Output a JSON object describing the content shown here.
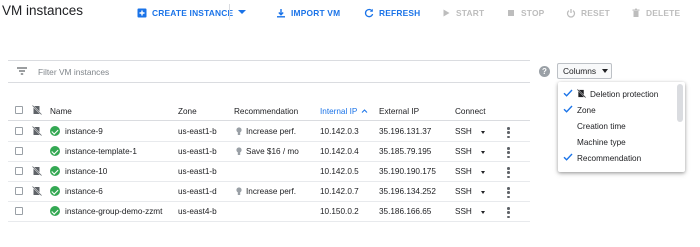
{
  "header": {
    "title": "VM instances"
  },
  "toolbar": {
    "create": "CREATE INSTANCE",
    "import": "IMPORT VM",
    "refresh": "REFRESH",
    "start": "START",
    "stop": "STOP",
    "reset": "RESET",
    "delete": "DELETE"
  },
  "filter": {
    "placeholder": "Filter VM instances"
  },
  "columns_button": {
    "label": "Columns"
  },
  "table": {
    "headers": {
      "name": "Name",
      "zone": "Zone",
      "recommendation": "Recommendation",
      "internal_ip": "Internal IP",
      "external_ip": "External IP",
      "connect": "Connect"
    },
    "rows": [
      {
        "name": "instance-9",
        "zone": "us-east1-b",
        "recommendation": "Increase perf.",
        "internal_ip": "10.142.0.3",
        "external_ip": "35.196.131.37",
        "connect": "SSH",
        "deletion_protection": true
      },
      {
        "name": "instance-template-1",
        "zone": "us-east1-b",
        "recommendation": "Save $16 / mo",
        "internal_ip": "10.142.0.4",
        "external_ip": "35.185.79.195",
        "connect": "SSH",
        "deletion_protection": false
      },
      {
        "name": "instance-10",
        "zone": "us-east1-b",
        "recommendation": "",
        "internal_ip": "10.142.0.5",
        "external_ip": "35.190.190.175",
        "connect": "SSH",
        "deletion_protection": true
      },
      {
        "name": "instance-6",
        "zone": "us-east1-d",
        "recommendation": "Increase perf.",
        "internal_ip": "10.142.0.7",
        "external_ip": "35.196.134.252",
        "connect": "SSH",
        "deletion_protection": true
      },
      {
        "name": "instance-group-demo-zzmt",
        "zone": "us-east4-b",
        "recommendation": "",
        "internal_ip": "10.150.0.2",
        "external_ip": "35.186.166.65",
        "connect": "SSH",
        "deletion_protection": false
      }
    ]
  },
  "columns_menu": {
    "items": [
      {
        "label": "Deletion protection",
        "checked": true,
        "icon": "deletion-protection-icon"
      },
      {
        "label": "Zone",
        "checked": true
      },
      {
        "label": "Creation time",
        "checked": false
      },
      {
        "label": "Machine type",
        "checked": false
      },
      {
        "label": "Recommendation",
        "checked": true
      }
    ]
  },
  "colors": {
    "accent": "#1a73e8",
    "status_ok": "#34a853",
    "disabled": "#bdbdbd"
  }
}
